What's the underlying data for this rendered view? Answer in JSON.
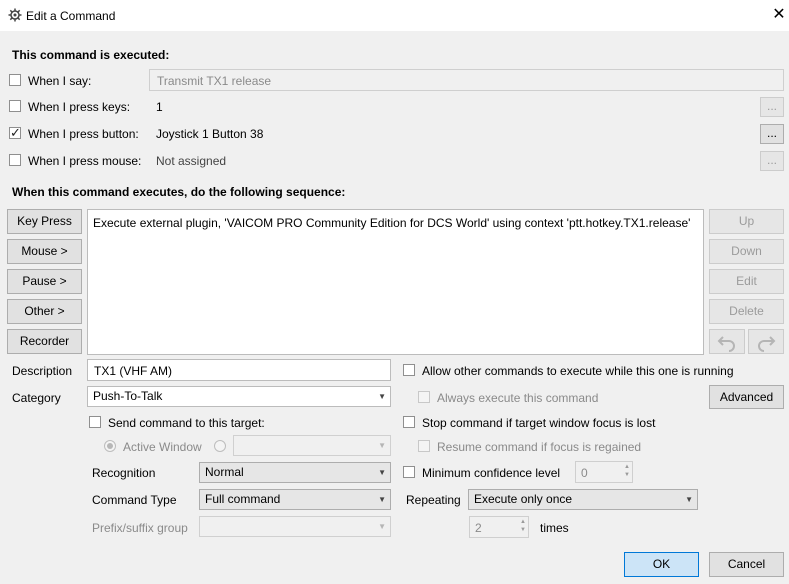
{
  "window": {
    "title": "Edit a Command",
    "icon": "gear-icon"
  },
  "sections": {
    "executed_heading": "This command is executed:",
    "sequence_heading": "When this command executes, do the following sequence:"
  },
  "triggers": {
    "say": {
      "label": "When I say:",
      "checked": false,
      "value": "Transmit TX1 release"
    },
    "keys": {
      "label": "When I press keys:",
      "checked": false,
      "value": "1"
    },
    "button": {
      "label": "When I press button:",
      "checked": true,
      "value": "Joystick 1 Button 38"
    },
    "mouse": {
      "label": "When I press mouse:",
      "checked": false,
      "value": "Not assigned"
    },
    "ellipsis": "..."
  },
  "sequence": {
    "buttons_left": [
      "Key Press",
      "Mouse >",
      "Pause >",
      "Other >",
      "Recorder"
    ],
    "buttons_right": [
      "Up",
      "Down",
      "Edit",
      "Delete"
    ],
    "items": [
      "Execute external plugin, 'VAICOM PRO Community Edition for DCS World' using context 'ptt.hotkey.TX1.release'"
    ]
  },
  "form": {
    "description_label": "Description",
    "description_value": "TX1 (VHF AM)",
    "category_label": "Category",
    "category_value": "Push-To-Talk",
    "send_target_label": "Send command to this target:",
    "active_window_label": "Active Window",
    "recognition_label": "Recognition",
    "recognition_value": "Normal",
    "command_type_label": "Command Type",
    "command_type_value": "Full command",
    "prefix_label": "Prefix/suffix group",
    "prefix_value": ""
  },
  "options": {
    "allow_other": "Allow other commands to execute while this one is running",
    "always_execute": "Always execute this command",
    "advanced": "Advanced",
    "stop_focus": "Stop command if target window focus is lost",
    "resume_focus": "Resume command if focus is regained",
    "min_confidence": "Minimum confidence level",
    "min_confidence_value": "0",
    "repeating_label": "Repeating",
    "repeating_value": "Execute only once",
    "times_value": "2",
    "times_label": "times"
  },
  "footer": {
    "ok": "OK",
    "cancel": "Cancel"
  }
}
